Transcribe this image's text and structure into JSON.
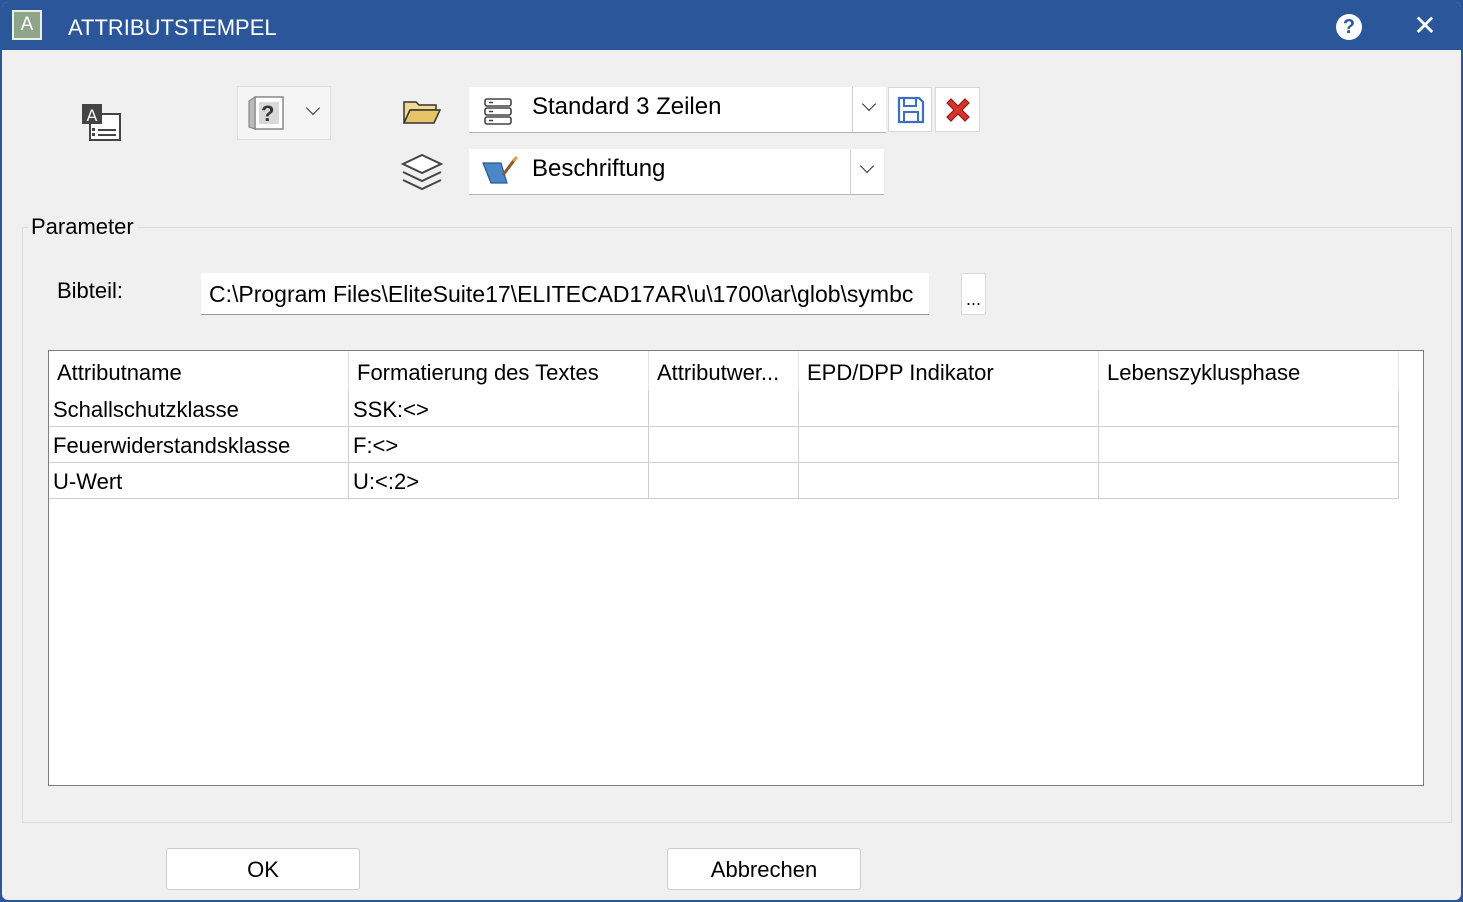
{
  "window": {
    "title": "ATTRIBUTSTEMPEL",
    "app_icon_letter": "A"
  },
  "toolbar": {
    "type_button_glyph": "?",
    "template_select": {
      "value": "Standard 3 Zeilen"
    },
    "layer_select": {
      "value": "Beschriftung"
    }
  },
  "parameter": {
    "legend": "Parameter",
    "library_label": "Bibteil:",
    "library_path": "C:\\Program Files\\EliteSuite17\\ELITECAD17AR\\u\\1700\\ar\\glob\\symbc",
    "browse_label": "..."
  },
  "table": {
    "columns": [
      "Attributname",
      "Formatierung des Textes",
      "Attributwer...",
      "EPD/DPP Indikator",
      "Lebenszyklusphase"
    ],
    "rows": [
      [
        "Schallschutzklasse",
        "SSK:<>",
        "",
        "",
        ""
      ],
      [
        "Feuerwiderstandsklasse",
        "F:<>",
        "",
        "",
        ""
      ],
      [
        "U-Wert",
        "U:<:2>",
        "",
        "",
        ""
      ]
    ]
  },
  "buttons": {
    "ok": "OK",
    "cancel": "Abbrechen"
  },
  "colors": {
    "titlebar": "#2b579a",
    "background": "#f0f0f0",
    "delete_red": "#d9342b",
    "save_blue": "#3a6fc4",
    "folder_yellow": "#e8c36a"
  }
}
